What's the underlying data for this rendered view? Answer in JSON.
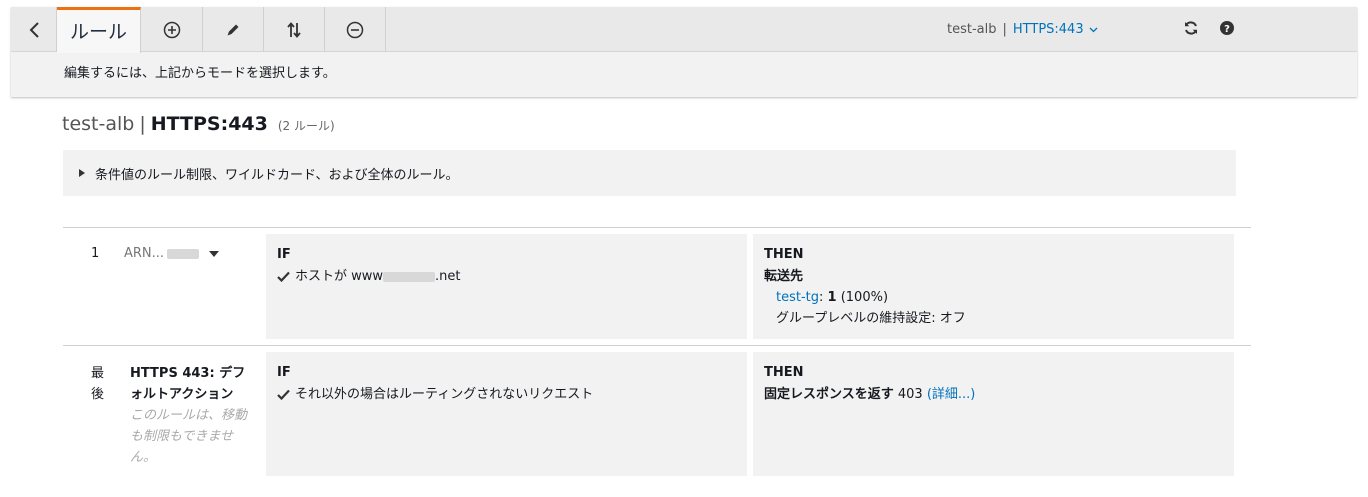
{
  "toolbar": {
    "active_tab": "ルール",
    "lb_name": "test-alb",
    "separator": "|",
    "listener": "HTTPS:443"
  },
  "hint": "編集するには、上記からモードを選択します。",
  "heading": {
    "lb_name": "test-alb",
    "pipe": "|",
    "listener": "HTTPS:443",
    "count": "(2 ルール)"
  },
  "info_box": "条件値のルール制限、ワイルドカード、および全体のルール。",
  "rules": [
    {
      "number": "1",
      "arn": "ARN...",
      "if_label": "IF",
      "condition_prefix": "ホストが www",
      "condition_suffix": ".net",
      "then_label": "THEN",
      "action": "転送先",
      "target": "test-tg",
      "target_weight": ": ",
      "weight_value": "1",
      "weight_pct": " (100%)",
      "stickiness": "グループレベルの維持設定: オフ"
    },
    {
      "number": "最後",
      "title": "HTTPS 443: デフォルトアクション",
      "description": "このルールは、移動も制限もできません。",
      "if_label": "IF",
      "condition": "それ以外の場合はルーティングされないリクエスト",
      "then_label": "THEN",
      "action": "固定レスポンスを返す",
      "status_code": " 403 ",
      "details_link": "(詳細...)"
    }
  ],
  "colors": {
    "accent": "#ec7211",
    "link": "#0073bb",
    "panel": "#f2f2f2"
  }
}
